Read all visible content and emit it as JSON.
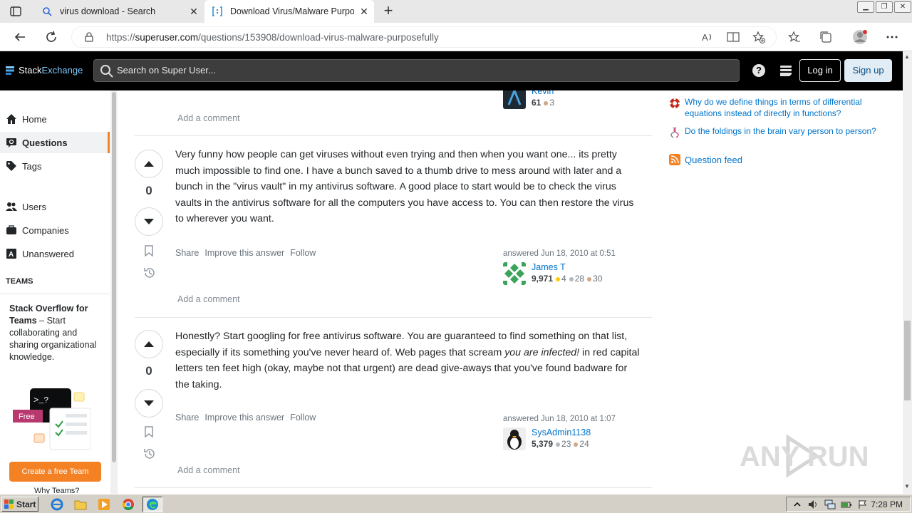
{
  "browser": {
    "tabs": [
      {
        "title": "virus download - Search",
        "active": false,
        "icon": "search-icon"
      },
      {
        "title": "Download Virus/Malware Purposefully",
        "active": true,
        "icon": "superuser-icon"
      }
    ],
    "url_domain": "superuser.com",
    "url_prefix": "https://",
    "url_path": "/questions/153908/download-virus-malware-purposefully"
  },
  "site": {
    "logo_part1": "Stack",
    "logo_part2": "Exchange",
    "search_placeholder": "Search on Super User...",
    "help_label": "?",
    "login_label": "Log in",
    "signup_label": "Sign up"
  },
  "leftnav": {
    "items": [
      {
        "label": "Home",
        "icon": "home-icon"
      },
      {
        "label": "Questions",
        "icon": "questions-icon",
        "active": true
      },
      {
        "label": "Tags",
        "icon": "tag-icon"
      },
      {
        "label": "Users",
        "icon": "users-icon"
      },
      {
        "label": "Companies",
        "icon": "briefcase-icon"
      },
      {
        "label": "Unanswered",
        "icon": "unanswered-icon"
      }
    ],
    "teams_heading": "TEAMS",
    "teams_title": "Stack Overflow for Teams",
    "teams_text": " – Start collaborating and sharing organizational knowledge.",
    "teams_prompt": ">_?",
    "teams_free": "Free",
    "teams_cta": "Create a free Team",
    "why_teams": "Why Teams?"
  },
  "previous_answer": {
    "user_name": "Kevin",
    "rep": "61",
    "bronze": "3",
    "add_comment": "Add a comment"
  },
  "answers": [
    {
      "votes": "0",
      "body": "Very funny how people can get viruses without even trying and then when you want one... its pretty much impossible to find one. I have a bunch saved to a thumb drive to mess around with later and a bunch in the \"virus vault\" in my antivirus software. A good place to start would be to check the virus vaults in the antivirus software for all the computers you have access to. You can then restore the virus to wherever you want.",
      "share": "Share",
      "improve": "Improve this answer",
      "follow": "Follow",
      "answered": "answered Jun 18, 2010 at 0:51",
      "user_name": "James T",
      "rep": "9,971",
      "gold": "4",
      "silver": "28",
      "bronze": "30",
      "add_comment": "Add a comment"
    },
    {
      "votes": "0",
      "body_part1": "Honestly? Start googling for free antivirus software. You are guaranteed to find something on that list, especially if its something you've never heard of. Web pages that scream ",
      "body_em": "you are infected!",
      "body_part2": " in red capital letters ten feet high (okay, maybe not that urgent) are dead give-aways that you've found badware for the taking.",
      "share": "Share",
      "improve": "Improve this answer",
      "follow": "Follow",
      "answered": "answered Jun 18, 2010 at 1:07",
      "user_name": "SysAdmin1138",
      "rep": "5,379",
      "silver": "23",
      "bronze": "24",
      "add_comment": "Add a comment"
    }
  ],
  "sidebar_right": {
    "hot_questions": [
      {
        "text": "Why do we define things in terms of differential equations instead of directly in functions?",
        "icon": "mathematics-site-icon"
      },
      {
        "text": "Do the foldings in the brain vary person to person?",
        "icon": "biology-site-icon"
      }
    ],
    "question_feed": "Question feed"
  },
  "watermark": "ANY RUN",
  "taskbar": {
    "start_label": "Start",
    "apps": [
      "ie-icon",
      "explorer-icon",
      "media-player-icon",
      "chrome-icon",
      "edge-icon"
    ],
    "time": "7:28 PM"
  }
}
